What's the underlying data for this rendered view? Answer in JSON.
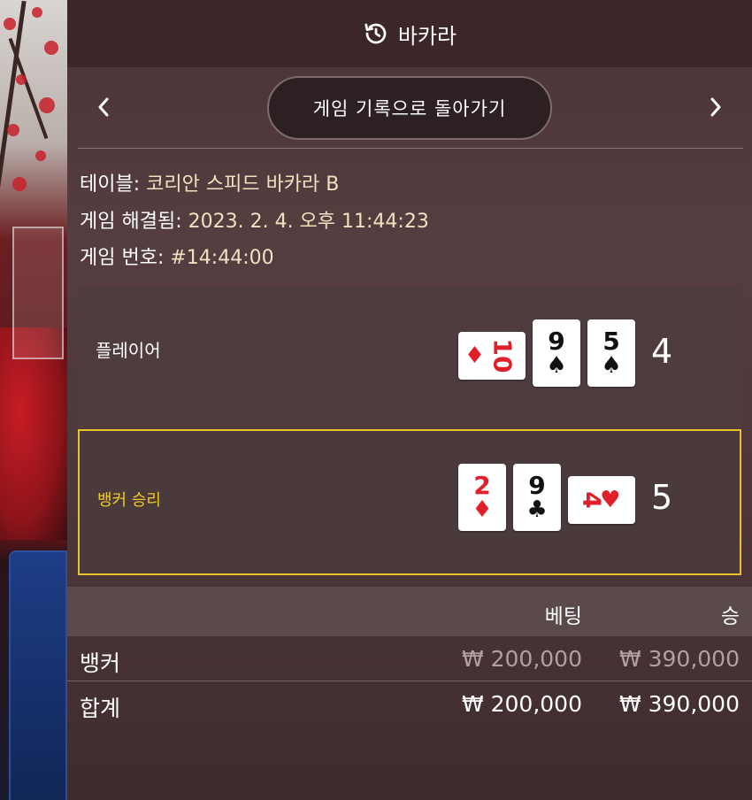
{
  "header": {
    "icon": "history-icon",
    "title": "바카라"
  },
  "nav": {
    "back_label": "게임 기록으로 돌아가기",
    "prev_icon": "chevron-left-icon",
    "next_icon": "chevron-right-icon"
  },
  "info": {
    "table_label": "테이블:",
    "table_value": "코리안 스피드 바카라 B",
    "resolved_label": "게임 해결됨:",
    "resolved_value": "2023. 2. 4. 오후 11:44:23",
    "game_no_label": "게임 번호:",
    "game_no_value": "#14:44:00"
  },
  "player": {
    "label": "플레이어",
    "score": "4",
    "cards": [
      {
        "rank": "10",
        "suit": "♦",
        "color": "red",
        "orientation": "side"
      },
      {
        "rank": "9",
        "suit": "♠",
        "color": "black",
        "orientation": "upright"
      },
      {
        "rank": "5",
        "suit": "♠",
        "color": "black",
        "orientation": "upright"
      }
    ]
  },
  "banker": {
    "label": "뱅커 승리",
    "score": "5",
    "cards": [
      {
        "rank": "2",
        "suit": "♦",
        "color": "red",
        "orientation": "upright"
      },
      {
        "rank": "9",
        "suit": "♣",
        "color": "black",
        "orientation": "upright"
      },
      {
        "rank": "4",
        "suit": "♥",
        "color": "red",
        "orientation": "side"
      }
    ]
  },
  "table": {
    "col_bet": "베팅",
    "col_win": "승",
    "rows": [
      {
        "name": "뱅커",
        "bet": "₩ 200,000",
        "win": "₩ 390,000"
      },
      {
        "name": "합계",
        "bet": "₩ 200,000",
        "win": "₩ 390,000"
      }
    ]
  },
  "colors": {
    "accent_gold": "#e6c32c",
    "panel_bg": "#4a3336"
  }
}
